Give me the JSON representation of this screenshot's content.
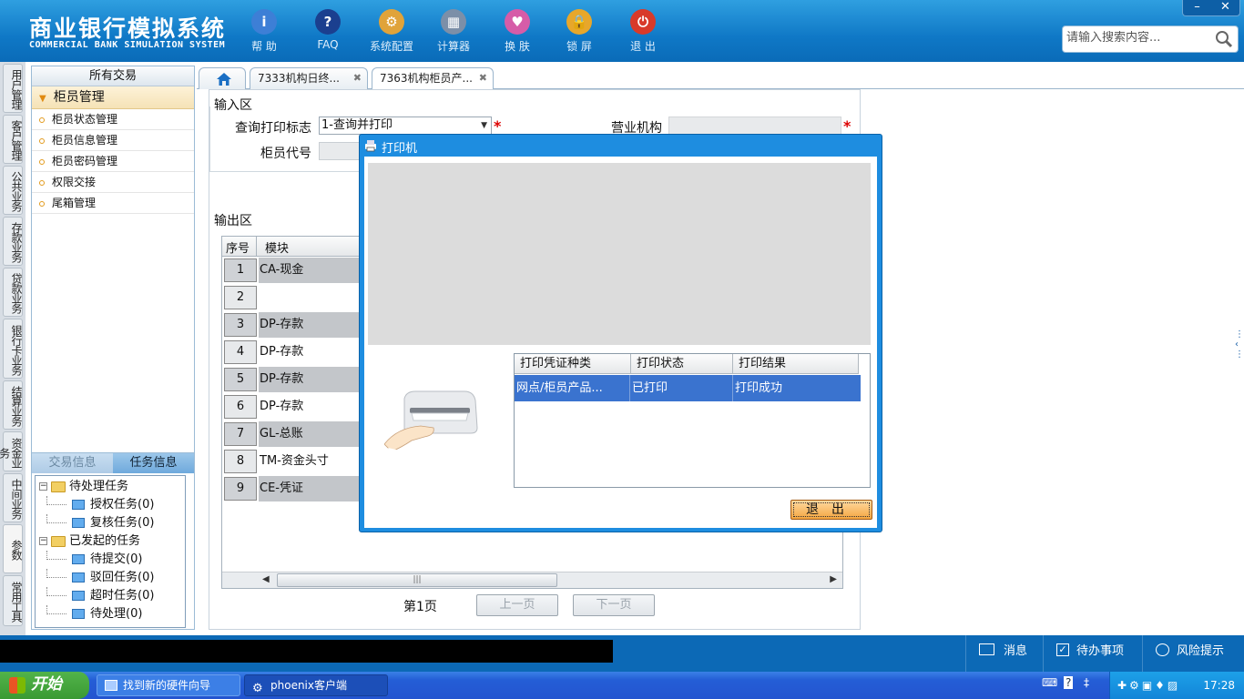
{
  "header": {
    "title_cn": "商业银行模拟系统",
    "title_en": "COMMERCIAL BANK SIMULATION SYSTEM",
    "toolbar": [
      {
        "label": "帮 助",
        "icon": "help-icon",
        "glyph": "i",
        "color": "#3d7fd6"
      },
      {
        "label": "FAQ",
        "icon": "faq-icon",
        "glyph": "?",
        "color": "#1b3f8f"
      },
      {
        "label": "系统配置",
        "icon": "system-config-icon",
        "glyph": "⚙",
        "color": "#e0a33a"
      },
      {
        "label": "计算器",
        "icon": "calculator-icon",
        "glyph": "▦",
        "color": "#7c8fa8"
      },
      {
        "label": "换 肤",
        "icon": "skin-icon",
        "glyph": "♥",
        "color": "#d65ca8"
      },
      {
        "label": "锁 屏",
        "icon": "lock-icon",
        "glyph": "🔒",
        "color": "#e7a72b"
      },
      {
        "label": "退 出",
        "icon": "exit-icon",
        "glyph": "⏻",
        "color": "#d83a2a"
      }
    ],
    "search_placeholder": "请输入搜索内容...",
    "window_min": "–",
    "window_close": "✕"
  },
  "vnav": [
    {
      "label": "用户管理"
    },
    {
      "label": "客户管理"
    },
    {
      "label": "公共业务"
    },
    {
      "label": "存款业务"
    },
    {
      "label": "贷款业务"
    },
    {
      "label": "银行卡业务"
    },
    {
      "label": "结算业务"
    },
    {
      "label": "资金业务"
    },
    {
      "label": "中间业务"
    },
    {
      "label": "参数"
    },
    {
      "label": "常用工具"
    }
  ],
  "sidebar": {
    "header": "所有交易",
    "group": "柜员管理",
    "items": [
      "柜员状态管理",
      "柜员信息管理",
      "柜员密码管理",
      "权限交接",
      "尾箱管理"
    ],
    "lower_tabs": [
      "交易信息",
      "任务信息"
    ],
    "tree": {
      "pending": "待处理任务",
      "pending_children": [
        "授权任务(0)",
        "复核任务(0)"
      ],
      "started": "已发起的任务",
      "started_children": [
        "待提交(0)",
        "驳回任务(0)",
        "超时任务(0)",
        "待处理(0)"
      ]
    }
  },
  "tabs": {
    "home_icon": "home-icon",
    "items": [
      "7333机构日终...",
      "7363机构柜员产..."
    ]
  },
  "form": {
    "input_section": "输入区",
    "query_flag_label": "查询打印标志",
    "query_flag_value": "1-查询并打印",
    "org_label": "营业机构",
    "org_value": "",
    "teller_label": "柜员代号",
    "teller_value": ""
  },
  "output": {
    "section": "输出区",
    "columns": [
      "序号",
      "模块"
    ],
    "rows": [
      {
        "no": "1",
        "module": "CA-现金"
      },
      {
        "no": "2",
        "module": ""
      },
      {
        "no": "3",
        "module": "DP-存款"
      },
      {
        "no": "4",
        "module": "DP-存款"
      },
      {
        "no": "5",
        "module": "DP-存款"
      },
      {
        "no": "6",
        "module": "DP-存款"
      },
      {
        "no": "7",
        "module": "GL-总账"
      },
      {
        "no": "8",
        "module": "TM-资金头寸"
      },
      {
        "no": "9",
        "module": "CE-凭证"
      }
    ],
    "page_label": "第1页",
    "prev_label": "上一页",
    "next_label": "下一页"
  },
  "dialog": {
    "title": "打印机",
    "columns": [
      "打印凭证种类",
      "打印状态",
      "打印结果"
    ],
    "row": {
      "type": "网点/柜员产品...",
      "status": "已打印",
      "result": "打印成功"
    },
    "exit_label": "退出"
  },
  "statusbar": {
    "message": "消息",
    "todo": "待办事项",
    "risk": "风险提示"
  },
  "taskbar": {
    "start": "开始",
    "tasks": [
      "找到新的硬件向导",
      "phoenix客户端"
    ],
    "clock": "17:28"
  }
}
